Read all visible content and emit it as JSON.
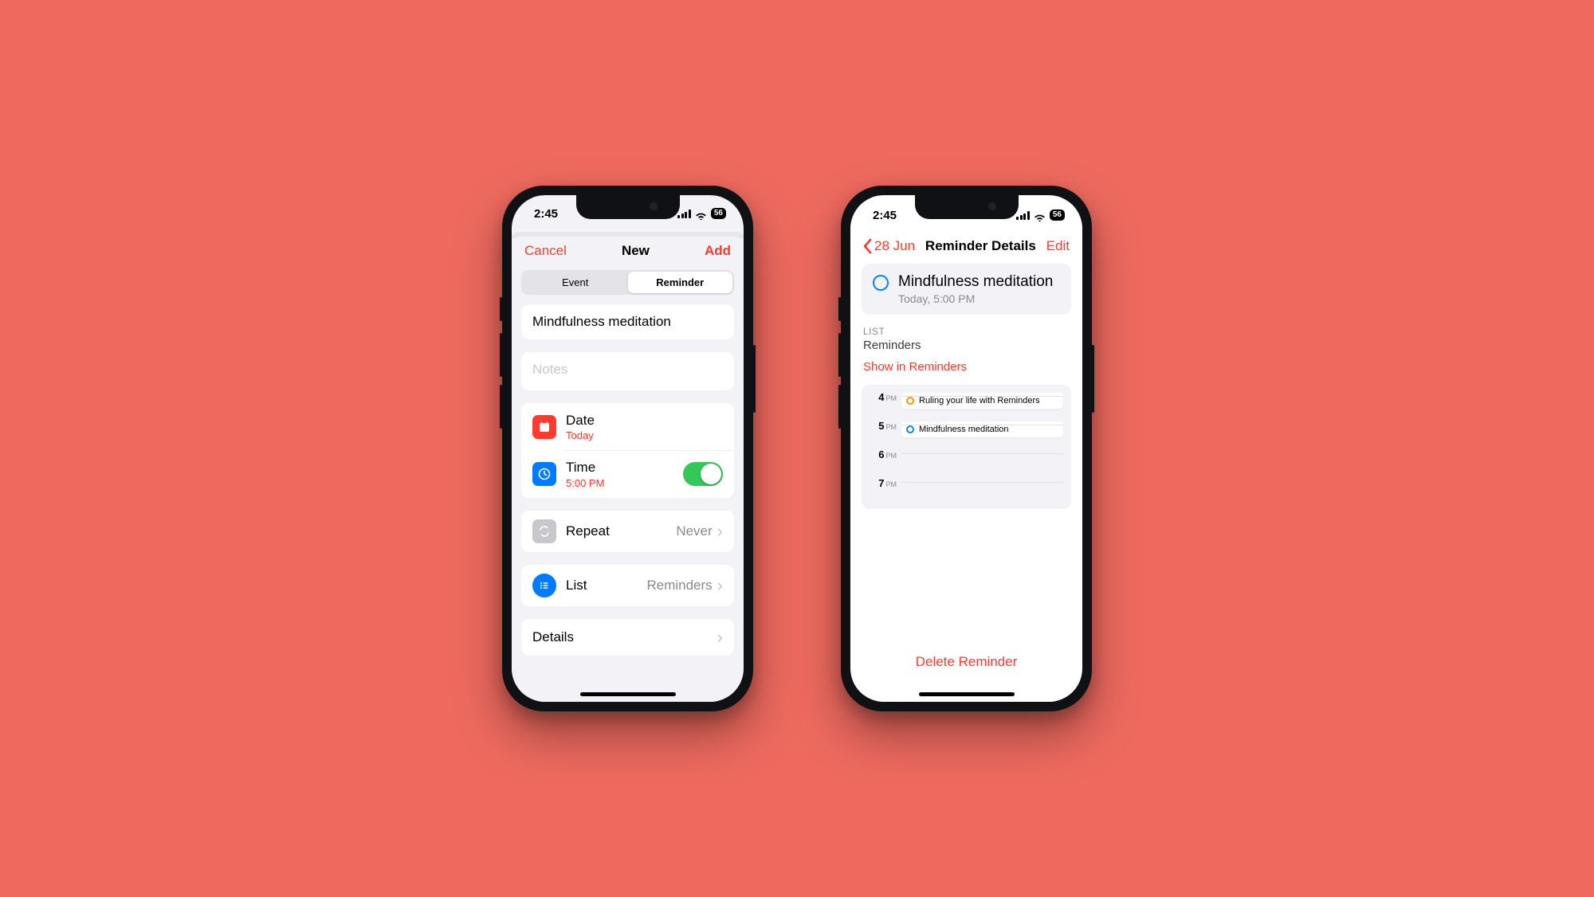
{
  "status": {
    "time": "2:45",
    "battery": "56"
  },
  "phoneA": {
    "header": {
      "cancel": "Cancel",
      "title": "New",
      "add": "Add"
    },
    "segment": {
      "event": "Event",
      "reminder": "Reminder"
    },
    "title_value": "Mindfulness meditation",
    "notes_placeholder": "Notes",
    "date": {
      "label": "Date",
      "value": "Today"
    },
    "time": {
      "label": "Time",
      "value": "5:00 PM",
      "enabled": true
    },
    "repeat": {
      "label": "Repeat",
      "value": "Never"
    },
    "list": {
      "label": "List",
      "value": "Reminders"
    },
    "details": {
      "label": "Details"
    }
  },
  "phoneB": {
    "header": {
      "back": "28 Jun",
      "title": "Reminder Details",
      "edit": "Edit"
    },
    "summary": {
      "title": "Mindfulness meditation",
      "subtitle": "Today, 5:00 PM"
    },
    "list_label": "LIST",
    "list_value": "Reminders",
    "show_link": "Show in Reminders",
    "timeline": {
      "hours": [
        "4",
        "5",
        "6",
        "7"
      ],
      "ampm": "PM",
      "events": [
        {
          "hour_index": 0,
          "title": "Ruling your life with Reminders",
          "color": "orange"
        },
        {
          "hour_index": 1,
          "title": "Mindfulness meditation",
          "color": "blue"
        }
      ]
    },
    "delete": "Delete Reminder"
  }
}
